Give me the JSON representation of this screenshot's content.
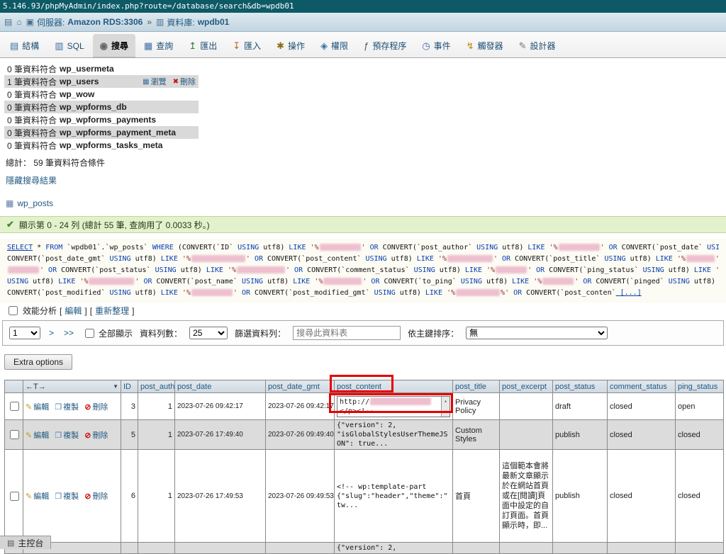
{
  "browser": {
    "url": "5.146.93/phpMyAdmin/index.php?route=/database/search&db=wpdb01"
  },
  "breadcrumb": {
    "server_label": "伺服器:",
    "server_value": "Amazon RDS:3306",
    "separator": "»",
    "db_label": "資料庫:",
    "db_value": "wpdb01"
  },
  "tabs": [
    {
      "id": "structure",
      "label": "結構",
      "icon": "▤",
      "color": "#3c6e9f"
    },
    {
      "id": "sql",
      "label": "SQL",
      "icon": "▥",
      "color": "#3c6e9f"
    },
    {
      "id": "search",
      "label": "搜尋",
      "icon": "◉",
      "color": "#666666",
      "active": true
    },
    {
      "id": "query",
      "label": "查詢",
      "icon": "▦",
      "color": "#3c6e9f"
    },
    {
      "id": "export",
      "label": "匯出",
      "icon": "↥",
      "color": "#2f7d32"
    },
    {
      "id": "import",
      "label": "匯入",
      "icon": "↧",
      "color": "#b06a1f"
    },
    {
      "id": "operations",
      "label": "操作",
      "icon": "✱",
      "color": "#8a6d1a"
    },
    {
      "id": "privileges",
      "label": "權限",
      "icon": "◈",
      "color": "#3c6e9f"
    },
    {
      "id": "routines",
      "label": "預存程序",
      "icon": "ƒ",
      "color": "#555555"
    },
    {
      "id": "events",
      "label": "事件",
      "icon": "◷",
      "color": "#3c6e9f"
    },
    {
      "id": "triggers",
      "label": "觸發器",
      "icon": "↯",
      "color": "#b08a00"
    },
    {
      "id": "designer",
      "label": "設計器",
      "icon": "✎",
      "color": "#777777"
    }
  ],
  "match_rows": [
    {
      "prefix": "0 筆資料符合",
      "table": "wp_usermeta"
    },
    {
      "prefix": "1 筆資料符合",
      "table": "wp_users",
      "browse": "瀏覽",
      "delete": "刪除"
    },
    {
      "prefix": "0 筆資料符合",
      "table": "wp_wow"
    },
    {
      "prefix": "0 筆資料符合",
      "table": "wp_wpforms_db"
    },
    {
      "prefix": "0 筆資料符合",
      "table": "wp_wpforms_payments"
    },
    {
      "prefix": "0 筆資料符合",
      "table": "wp_wpforms_payment_meta"
    },
    {
      "prefix": "0 筆資料符合",
      "table": "wp_wpforms_tasks_meta"
    }
  ],
  "total_line": "總計： 59 筆資料符合條件",
  "hide_link": "隱藏搜尋結果",
  "posts_table": "wp_posts",
  "success": {
    "icon": "✔",
    "text": "顯示第 0 - 24 列 (總計 55 筆, 查詢用了 0.0033 秒。)"
  },
  "sql": {
    "lines": [
      [
        [
          "kwl",
          "SELECT"
        ],
        [
          "t",
          " * "
        ],
        [
          "kw",
          "FROM"
        ],
        [
          "t",
          " `wpdb01`.`wp_posts` "
        ],
        [
          "kw",
          "WHERE"
        ],
        [
          "t",
          " (CONVERT(`ID` "
        ],
        [
          "kw",
          "USING"
        ],
        [
          "t",
          " utf8) "
        ],
        [
          "kw",
          "LIKE"
        ],
        [
          "s",
          " '%"
        ],
        [
          "red",
          58
        ],
        [
          "s",
          "'"
        ],
        [
          "kw",
          " OR"
        ],
        [
          "t",
          " CONVERT(`post_author` "
        ],
        [
          "kw",
          "USING"
        ],
        [
          "t",
          " utf8) "
        ],
        [
          "kw",
          "LIKE"
        ],
        [
          "s",
          " '%"
        ],
        [
          "red",
          58
        ],
        [
          "s",
          "'"
        ],
        [
          "kw",
          " OR"
        ],
        [
          "t",
          " CONVERT(`post_date` "
        ],
        [
          "kw",
          "USING"
        ],
        [
          "t",
          " u"
        ]
      ],
      [
        [
          "t",
          "CONVERT(`post_date_gmt` "
        ],
        [
          "kw",
          "USING"
        ],
        [
          "t",
          " utf8) "
        ],
        [
          "kw",
          "LIKE"
        ],
        [
          "s",
          " '%"
        ],
        [
          "red",
          76
        ],
        [
          "s",
          "'"
        ],
        [
          "kw",
          " OR"
        ],
        [
          "t",
          " CONVERT(`post_content` "
        ],
        [
          "kw",
          "USING"
        ],
        [
          "t",
          " utf8) "
        ],
        [
          "kw",
          "LIKE"
        ],
        [
          "s",
          " '%"
        ],
        [
          "red",
          64
        ],
        [
          "s",
          "'"
        ],
        [
          "kw",
          " OR"
        ],
        [
          "t",
          " CONVERT(`post_title` "
        ],
        [
          "kw",
          "USING"
        ],
        [
          "t",
          " utf8) "
        ],
        [
          "kw",
          "LIKE"
        ],
        [
          "s",
          " '%"
        ],
        [
          "red",
          40
        ],
        [
          "s",
          "'"
        ],
        [
          "kw",
          " O"
        ]
      ],
      [
        [
          "red",
          44
        ],
        [
          "s",
          "'"
        ],
        [
          "kw",
          " OR"
        ],
        [
          "t",
          " CONVERT(`post_status` "
        ],
        [
          "kw",
          "USING"
        ],
        [
          "t",
          " utf8) "
        ],
        [
          "kw",
          "LIKE"
        ],
        [
          "s",
          " '%"
        ],
        [
          "red",
          68
        ],
        [
          "s",
          "'"
        ],
        [
          "kw",
          " OR"
        ],
        [
          "t",
          " CONVERT(`comment_status` "
        ],
        [
          "kw",
          "USING"
        ],
        [
          "t",
          " utf8) "
        ],
        [
          "kw",
          "LIKE"
        ],
        [
          "s",
          " '%"
        ],
        [
          "red",
          44
        ],
        [
          "s",
          "'"
        ],
        [
          "kw",
          " OR"
        ],
        [
          "t",
          " CONVERT(`ping_status` "
        ],
        [
          "kw",
          "USING"
        ],
        [
          "t",
          " utf8) "
        ],
        [
          "kw",
          "LIKE"
        ],
        [
          "s",
          " '"
        ]
      ],
      [
        [
          "kw",
          "USING"
        ],
        [
          "t",
          " utf8) "
        ],
        [
          "kw",
          "LIKE"
        ],
        [
          "s",
          " '%"
        ],
        [
          "red",
          64
        ],
        [
          "s",
          "'"
        ],
        [
          "kw",
          " OR"
        ],
        [
          "t",
          " CONVERT(`post_name` "
        ],
        [
          "kw",
          "USING"
        ],
        [
          "t",
          " utf8) "
        ],
        [
          "kw",
          "LIKE"
        ],
        [
          "s",
          " '%"
        ],
        [
          "red",
          54
        ],
        [
          "s",
          "'"
        ],
        [
          "kw",
          " OR"
        ],
        [
          "t",
          " CONVERT(`to_ping` "
        ],
        [
          "kw",
          "USING"
        ],
        [
          "t",
          " utf8) "
        ],
        [
          "kw",
          "LIKE"
        ],
        [
          "s",
          " '%"
        ],
        [
          "red",
          44
        ],
        [
          "s",
          "'"
        ],
        [
          "kw",
          " OR"
        ],
        [
          "t",
          " CONVERT(`pinged` "
        ],
        [
          "kw",
          "USING"
        ],
        [
          "t",
          " utf8)"
        ]
      ],
      [
        [
          "t",
          "CONVERT(`post_modified` "
        ],
        [
          "kw",
          "USING"
        ],
        [
          "t",
          " utf8) "
        ],
        [
          "kw",
          "LIKE"
        ],
        [
          "s",
          " '%"
        ],
        [
          "red",
          58
        ],
        [
          "s",
          "'"
        ],
        [
          "kw",
          " OR"
        ],
        [
          "t",
          " CONVERT(`post_modified_gmt` "
        ],
        [
          "kw",
          "USING"
        ],
        [
          "t",
          " utf8) "
        ],
        [
          "kw",
          "LIKE"
        ],
        [
          "s",
          " '%"
        ],
        [
          "red",
          62
        ],
        [
          "s",
          "%'"
        ],
        [
          "kw",
          " OR"
        ],
        [
          "t",
          " CONVERT(`post_conten`"
        ],
        [
          "kwl",
          " [...]"
        ]
      ]
    ]
  },
  "profiling": {
    "label": "效能分析",
    "lb": "[",
    "edit": "編輯",
    "rb": "]",
    "refresh": "重新整理"
  },
  "pager": {
    "page_value": "1",
    "next_label": ">",
    "last_label": ">>",
    "show_all_label": "全部顯示",
    "rows_label": "資料列數：",
    "rows_value": "25",
    "filter_label": "篩選資料列：",
    "filter_placeholder": "搜尋此資料表",
    "sort_label": "依主鍵排序：",
    "sort_value": "無"
  },
  "extra_options_label": "Extra options",
  "grid": {
    "options_header": "←T→",
    "sort_icon": "▼",
    "headers": [
      "ID",
      "post_author",
      "post_date",
      "post_date_gmt",
      "post_content",
      "post_title",
      "post_excerpt",
      "post_status",
      "comment_status",
      "ping_status"
    ],
    "action_labels": {
      "edit": "編輯",
      "copy": "複製",
      "delete": "刪除"
    },
    "rows": [
      {
        "id": "3",
        "author": "1",
        "date": "2023-07-26 09:42:17",
        "date_gmt": "2023-07-26 09:42:17",
        "content_box": {
          "line1": "http://",
          "redact_w": 86,
          "line2": "</p><!--"
        },
        "title": "Privacy Policy",
        "excerpt": "",
        "status": "draft",
        "comment": "closed",
        "ping": "open"
      },
      {
        "id": "5",
        "author": "1",
        "date": "2023-07-26 17:49:40",
        "date_gmt": "2023-07-26 09:49:40",
        "content": "{\"version\": 2, \"isGlobalStylesUserThemeJSON\": true...",
        "title": "Custom Styles",
        "excerpt": "",
        "status": "publish",
        "comment": "closed",
        "ping": "closed",
        "shade": true
      },
      {
        "id": "6",
        "author": "1",
        "date": "2023-07-26 17:49:53",
        "date_gmt": "2023-07-26 09:49:53",
        "content": "<!-- wp:template-part {\"slug\":\"header\",\"theme\":\"tw...",
        "title": "首頁",
        "excerpt": "這個範本會將最新文章顯示於在網站首頁或在[閱讀]頁面中設定的自訂頁面。首頁顯示時，即...",
        "status": "publish",
        "comment": "closed",
        "ping": "closed"
      },
      {
        "id": "",
        "author": "",
        "date": "",
        "date_gmt": "",
        "content": "{\"version\": 2,",
        "title": "",
        "excerpt": "",
        "status": "",
        "comment": "",
        "ping": "",
        "partial": true,
        "shade": true
      }
    ]
  },
  "console": {
    "label": "主控台"
  },
  "annotations": {
    "color": "#e60000",
    "redact_color": "#eec0cf"
  }
}
